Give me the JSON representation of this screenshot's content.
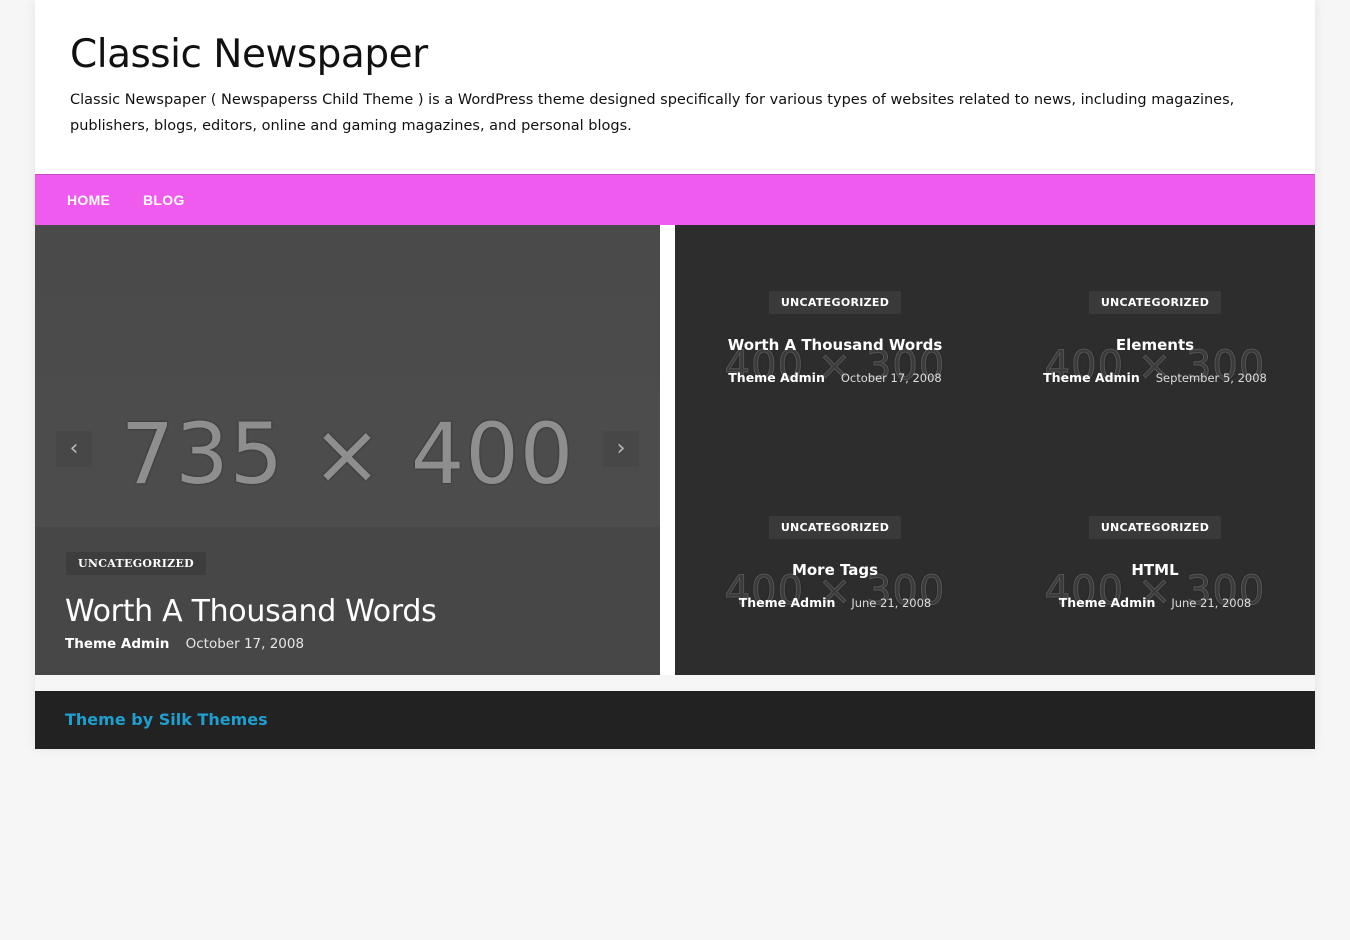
{
  "site": {
    "title": "Classic Newspaper",
    "description": "Classic Newspaper ( Newspaperss Child Theme ) is a WordPress theme designed specifically for various types of websites related to news, including magazines, publishers, blogs, editors, online and gaming magazines, and personal blogs."
  },
  "nav": {
    "items": [
      {
        "label": "HOME"
      },
      {
        "label": "BLOG"
      }
    ]
  },
  "slider": {
    "placeholder": "735 × 400",
    "prev_icon": "chevron-left-icon",
    "next_icon": "chevron-right-icon",
    "category": "UNCATEGORIZED",
    "title": "Worth A Thousand Words",
    "author": "Theme Admin",
    "date": "October 17, 2008"
  },
  "grid": {
    "placeholder": "400 × 300",
    "posts": [
      {
        "category": "UNCATEGORIZED",
        "title": "Worth A Thousand Words",
        "author": "Theme Admin",
        "date": "October 17, 2008"
      },
      {
        "category": "UNCATEGORIZED",
        "title": "Elements",
        "author": "Theme Admin",
        "date": "September 5, 2008"
      },
      {
        "category": "UNCATEGORIZED",
        "title": "More Tags",
        "author": "Theme Admin",
        "date": "June 21, 2008"
      },
      {
        "category": "UNCATEGORIZED",
        "title": "HTML",
        "author": "Theme Admin",
        "date": "June 21, 2008"
      }
    ]
  },
  "footer": {
    "credit": "Theme by Silk Themes"
  },
  "colors": {
    "nav_bg": "#ee5bee",
    "footer_link": "#1e9fd0",
    "grid_bg": "#2d2d2d",
    "footer_bg": "#222222"
  }
}
